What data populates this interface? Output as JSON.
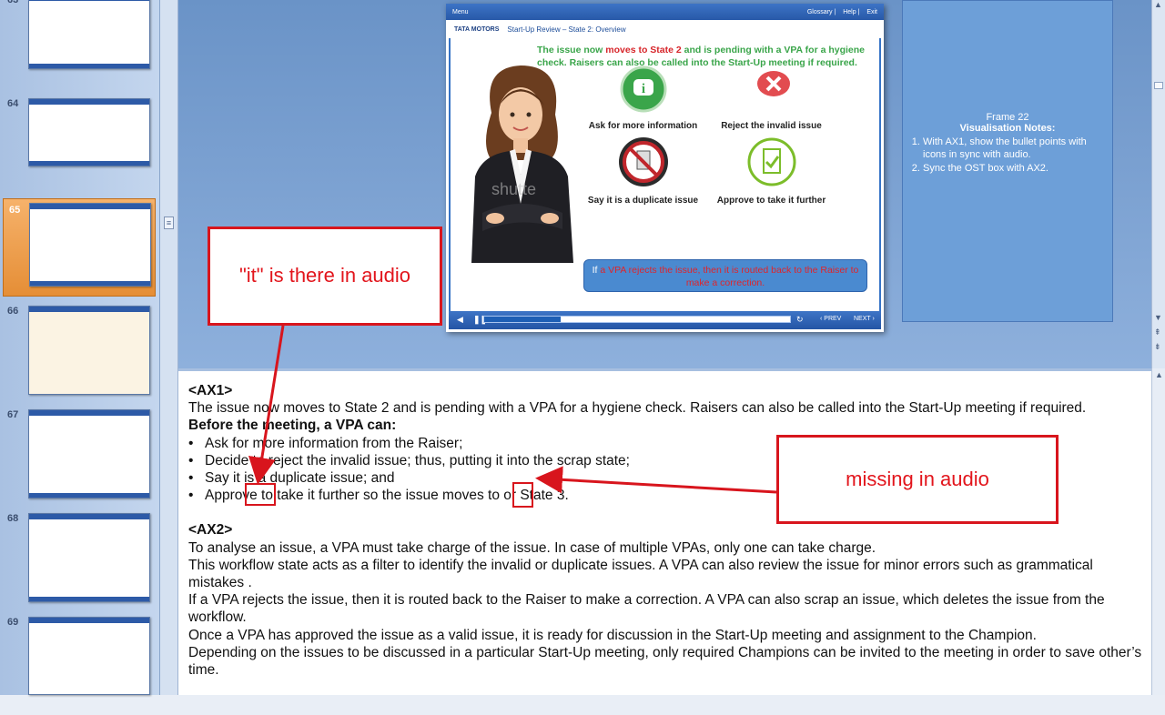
{
  "thumbnails": [
    {
      "num": "63"
    },
    {
      "num": "64"
    },
    {
      "num": "65",
      "selected": true
    },
    {
      "num": "66"
    },
    {
      "num": "67"
    },
    {
      "num": "68"
    },
    {
      "num": "69"
    }
  ],
  "slide": {
    "top_menu": "Menu",
    "top_links": [
      "Glossary",
      "Help",
      "Exit"
    ],
    "brand": "TATA MOTORS",
    "title": "Start-Up Review – State 2: Overview",
    "lead_1": "The issue now",
    "lead_red": "moves to State 2",
    "lead_2": "and is pending with a VPA for a hygiene check. Raisers can also be called into the",
    "lead_bold": "Start-Up meeting",
    "lead_3": "if required.",
    "items": [
      {
        "label": "Ask for more information",
        "icon": "info-icon",
        "color": "#3aa54a"
      },
      {
        "label": "Reject the invalid issue",
        "icon": "reject-icon",
        "color": "#e24c50"
      },
      {
        "label": "Say it is a duplicate issue",
        "icon": "duplicate-icon",
        "color": "#c0262c"
      },
      {
        "label": "Approve to take it further",
        "icon": "approve-icon",
        "color": "#7cbd2a"
      }
    ],
    "ost_prefix": "If",
    "ost_text": "a VPA rejects the issue, then it is routed back to the Raiser to make a correction.",
    "watermark": "shutte",
    "player": {
      "prev": "PREV",
      "next": "NEXT",
      "progress": 0.25
    }
  },
  "vis_notes": {
    "frame": "Frame 22",
    "heading": "Visualisation Notes:",
    "items": [
      "With AX1, show the bullet points with icons in sync with audio.",
      "Sync the OST box with AX2."
    ]
  },
  "notes": {
    "ax1": "<AX1>",
    "ax1_p": "The issue now moves to State 2 and is pending with a VPA for a hygiene check. Raisers can also be called into the Start-Up meeting if required.",
    "before": "Before the meeting, a VPA can:",
    "bullets": [
      "Ask for more information from the Raiser;",
      "Decide to reject the invalid issue; thus, putting it into the scrap state;",
      "Say it is a duplicate issue; and",
      "Approve to take it further so the issue moves to or State 3."
    ],
    "ax2": "<AX2>",
    "ax2_lines": [
      "To analyse an issue, a VPA must take charge of the issue. In case of multiple VPAs, only one can take charge.",
      "This workflow state acts as a filter to identify the invalid or duplicate issues. A VPA can also review the issue for minor errors such as grammatical mistakes .",
      "If a VPA rejects the issue, then it is routed back to the Raiser to make a correction. A VPA can also scrap an issue, which deletes the issue from the workflow.",
      "Once a VPA has approved the issue as a valid issue, it is ready for discussion in the Start-Up meeting and assignment to the Champion.",
      "Depending on the issues to be discussed in a particular Start-Up meeting, only required Champions can be invited to the meeting in order to save other’s time."
    ]
  },
  "callouts": {
    "left": "\"it\" is there in audio",
    "right": "missing in audio"
  },
  "colors": {
    "accent": "#2859a8",
    "callout": "#d8151d",
    "selected_thumb": "#e58e36"
  }
}
